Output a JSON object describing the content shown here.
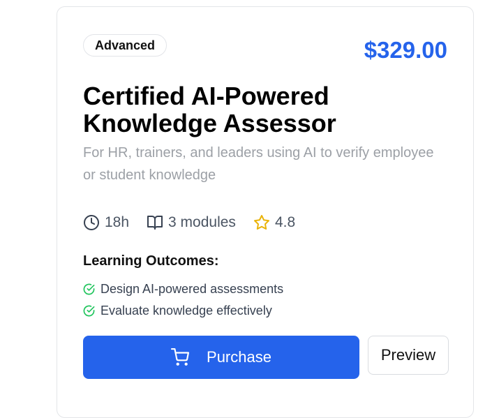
{
  "course": {
    "level_badge": "Advanced",
    "price": "$329.00",
    "title": "Certified AI-Powered Knowledge Assessor",
    "description": "For HR, trainers, and leaders using AI to verify employee or student knowledge",
    "stats": {
      "duration": "18h",
      "modules": "3 modules",
      "rating": "4.8"
    },
    "outcomes_heading": "Learning Outcomes:",
    "outcomes": [
      "Design AI-powered assessments",
      "Evaluate knowledge effectively"
    ],
    "purchase_label": "Purchase",
    "preview_label": "Preview"
  },
  "colors": {
    "accent": "#2563eb",
    "star": "#eab308",
    "check": "#22c55e",
    "muted_text": "#9ca0a6"
  },
  "icons": {
    "duration": "clock-icon",
    "modules": "book-open-icon",
    "rating": "star-icon",
    "outcome": "check-circle-icon",
    "purchase": "shopping-cart-icon"
  }
}
